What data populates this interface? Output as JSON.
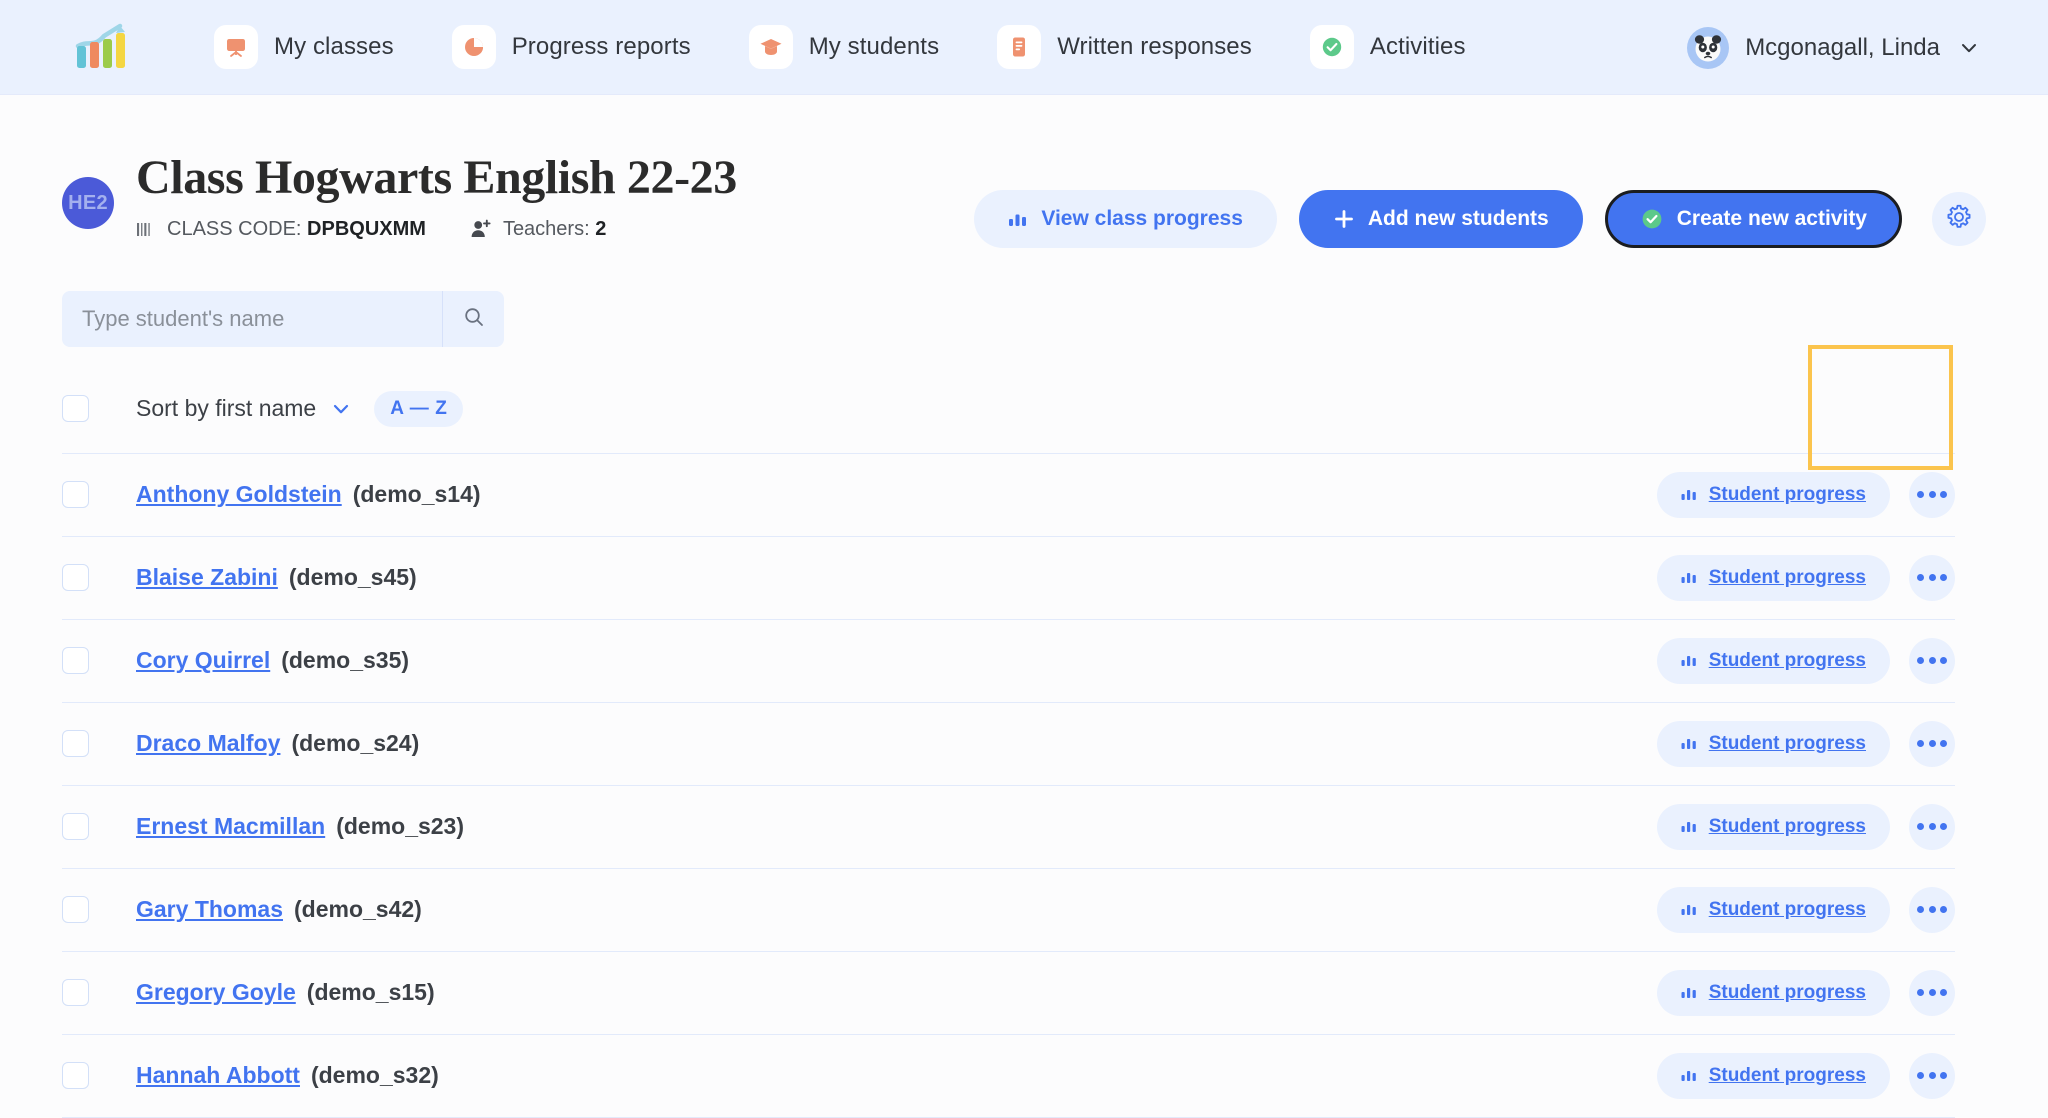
{
  "nav": {
    "logo_icon": "bar-chart-logo",
    "items": [
      {
        "label": "My classes",
        "icon": "whiteboard-icon"
      },
      {
        "label": "Progress reports",
        "icon": "pie-chart-icon"
      },
      {
        "label": "My students",
        "icon": "graduation-cap-icon"
      },
      {
        "label": "Written responses",
        "icon": "document-list-icon"
      },
      {
        "label": "Activities",
        "icon": "check-circle-icon"
      }
    ],
    "user": {
      "name": "Mcgonagall, Linda",
      "avatar_icon": "panda-avatar-icon",
      "caret_icon": "chevron-down-icon"
    }
  },
  "header": {
    "class_initials": "HE2",
    "title": "Class Hogwarts English 22-23",
    "class_code_label": "CLASS CODE:",
    "class_code": "DPBQUXMM",
    "class_code_icon": "barcode-icon",
    "teachers_label": "Teachers:",
    "teachers_count": "2",
    "teachers_icon": "user-plus-icon"
  },
  "actions": {
    "view_progress": {
      "label": "View class progress",
      "icon": "bar-chart-icon"
    },
    "add_students": {
      "label": "Add new students",
      "icon": "plus-icon"
    },
    "create_activity": {
      "label": "Create new activity",
      "icon": "check-circle-icon"
    },
    "settings": {
      "icon": "gear-icon"
    },
    "highlight_color": "#fbc44d"
  },
  "search": {
    "placeholder": "Type student's name",
    "value": "",
    "button_icon": "search-icon"
  },
  "sort": {
    "select_all_checkbox": "unchecked",
    "label": "Sort by first name",
    "caret_icon": "chevron-down-icon",
    "order": "A — Z"
  },
  "list": {
    "progress_label": "Student progress",
    "progress_icon": "bar-chart-icon",
    "more_icon": "ellipsis-icon",
    "students": [
      {
        "name": "Anthony Goldstein",
        "username": "(demo_s14)"
      },
      {
        "name": "Blaise Zabini",
        "username": "(demo_s45)"
      },
      {
        "name": "Cory Quirrel",
        "username": "(demo_s35)"
      },
      {
        "name": "Draco Malfoy",
        "username": "(demo_s24)"
      },
      {
        "name": "Ernest Macmillan",
        "username": "(demo_s23)"
      },
      {
        "name": "Gary Thomas",
        "username": "(demo_s42)"
      },
      {
        "name": "Gregory Goyle",
        "username": "(demo_s15)"
      },
      {
        "name": "Hannah Abbott",
        "username": "(demo_s32)"
      }
    ]
  },
  "colors": {
    "nav_bg": "#eaf1fe",
    "accent_blue": "#4274f0",
    "accent_orange": "#ef9270",
    "accent_green": "#5cc98a",
    "highlight": "#fbc44d"
  }
}
